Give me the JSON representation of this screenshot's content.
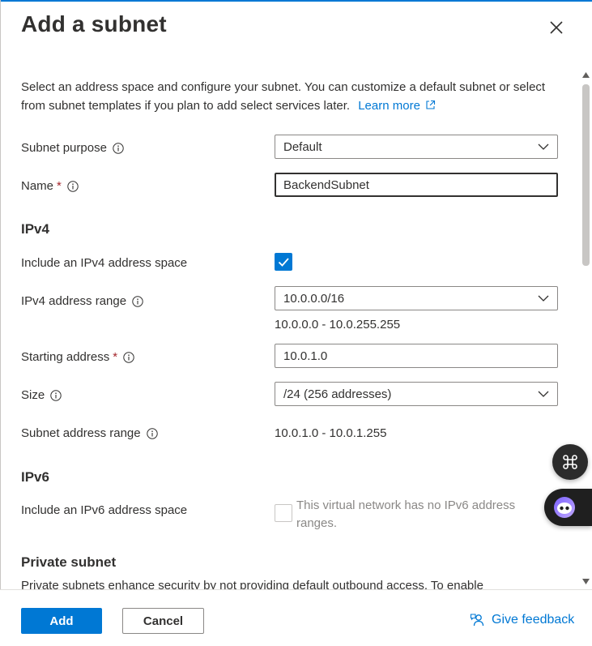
{
  "header": {
    "title": "Add a subnet",
    "close_label": "Close"
  },
  "description": {
    "text": "Select an address space and configure your subnet. You can customize a default subnet or select from subnet templates if you plan to add select services later.",
    "learn_more": "Learn more"
  },
  "form": {
    "subnet_purpose": {
      "label": "Subnet purpose",
      "value": "Default"
    },
    "name": {
      "label": "Name",
      "required_mark": "*",
      "value": "BackendSubnet"
    },
    "ipv4": {
      "section_title": "IPv4",
      "include_label": "Include an IPv4 address space",
      "include_checked": true,
      "range_label": "IPv4 address range",
      "range_value": "10.0.0.0/16",
      "range_hint": "10.0.0.0 - 10.0.255.255",
      "starting_label": "Starting address",
      "starting_required": "*",
      "starting_value": "10.0.1.0",
      "size_label": "Size",
      "size_value": "/24 (256 addresses)",
      "subnet_range_label": "Subnet address range",
      "subnet_range_value": "10.0.1.0 - 10.0.1.255"
    },
    "ipv6": {
      "section_title": "IPv6",
      "include_label": "Include an IPv6 address space",
      "include_checked": false,
      "disabled_note": "This virtual network has no IPv6 address ranges."
    },
    "private_subnet": {
      "section_title": "Private subnet",
      "description": "Private subnets enhance security by not providing default outbound access. To enable"
    }
  },
  "footer": {
    "add_label": "Add",
    "cancel_label": "Cancel",
    "feedback_label": "Give feedback"
  },
  "colors": {
    "accent": "#0078d4",
    "required": "#a4262c",
    "text": "#323130",
    "muted": "#8a8886"
  },
  "icons": {
    "close": "close-icon",
    "external_link": "external-link-icon",
    "info": "info-icon",
    "chevron": "chevron-down-icon",
    "check": "checkmark-icon",
    "feedback": "feedback-icon",
    "shortcut": "command-icon",
    "copilot": "copilot-icon"
  }
}
